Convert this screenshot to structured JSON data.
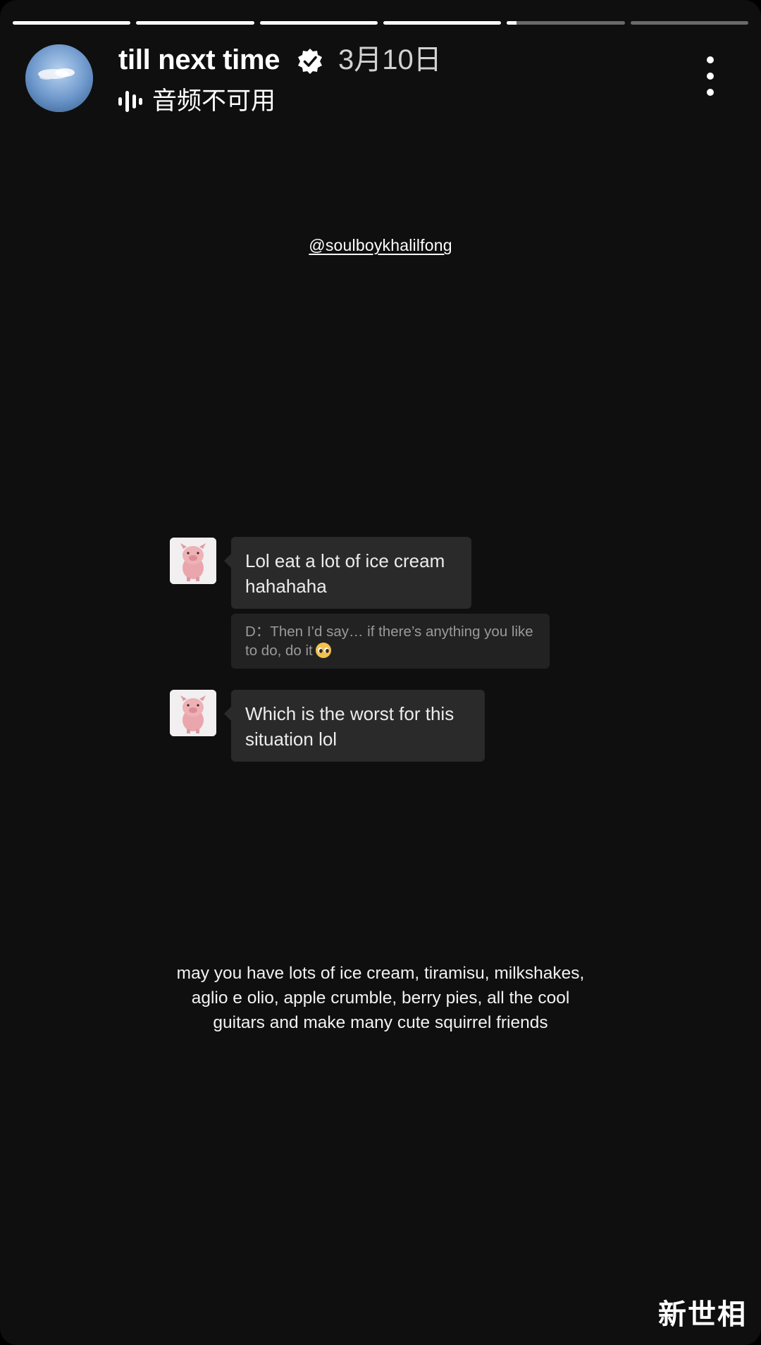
{
  "story": {
    "progress": [
      1,
      1,
      1,
      1,
      0.08,
      0
    ],
    "username": "till next time",
    "date": "3月10日",
    "audio_status": "音频不可用",
    "mention": "@soulboykhalilfong"
  },
  "chat": {
    "messages": [
      {
        "text": "Lol eat a lot of ice cream hahahaha"
      },
      {
        "text": "Which is the worst for this situation lol"
      }
    ],
    "quote": "D：Then I’d say… if there’s anything you like to do, do it"
  },
  "caption": {
    "line1": "may you have lots of ice cream, tiramisu, milkshakes,",
    "line2": "aglio e olio, apple crumble, berry pies, all the cool",
    "line3": "guitars and make many cute squirrel friends"
  },
  "watermark": "新世相",
  "icons": {
    "verified": "verified-badge-icon",
    "audio": "audio-waveform-icon",
    "more": "more-options-icon"
  },
  "colors": {
    "background": "#0f0f0f",
    "bubble": "#2a2a2a",
    "quote_bg": "#222222",
    "quote_text": "#9a9a9a"
  }
}
